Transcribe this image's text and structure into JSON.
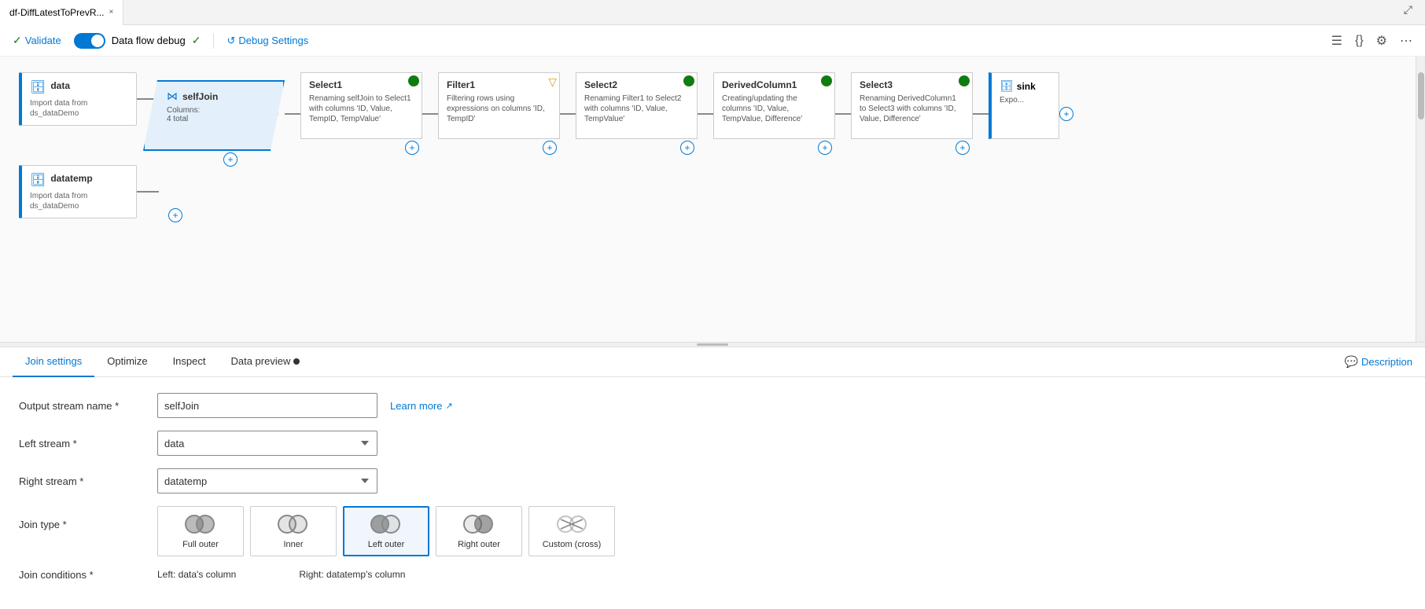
{
  "tab": {
    "title": "df-DiffLatestToPrevR...",
    "close_label": "×"
  },
  "toolbar": {
    "validate_label": "Validate",
    "debug_label": "Data flow debug",
    "debug_settings_label": "Debug Settings",
    "description_label": "Description"
  },
  "pipeline": {
    "nodes": [
      {
        "id": "data",
        "type": "source",
        "title": "data",
        "desc": "Import data from ds_dataDemo"
      },
      {
        "id": "datatemp",
        "type": "source",
        "title": "datatemp",
        "desc": "Import data from ds_dataDemo"
      },
      {
        "id": "selfJoin",
        "type": "join",
        "title": "selfJoin",
        "desc": "Columns: 4 total"
      },
      {
        "id": "Select1",
        "type": "transform",
        "title": "Select1",
        "desc": "Renaming selfJoin to Select1 with columns 'ID, Value, TempID, TempValue'"
      },
      {
        "id": "Filter1",
        "type": "filter",
        "title": "Filter1",
        "desc": "Filtering rows using expressions on columns 'ID, TempID'"
      },
      {
        "id": "Select2",
        "type": "transform",
        "title": "Select2",
        "desc": "Renaming Filter1 to Select2 with columns 'ID, Value, TempValue'"
      },
      {
        "id": "DerivedColumn1",
        "type": "transform",
        "title": "DerivedColumn1",
        "desc": "Creating/updating the columns 'ID, Value, TempValue, Difference'"
      },
      {
        "id": "Select3",
        "type": "transform",
        "title": "Select3",
        "desc": "Renaming DerivedColumn1 to Select3 with columns 'ID, Value, Difference'"
      },
      {
        "id": "sink",
        "type": "sink",
        "title": "sink",
        "desc": "Expo..."
      }
    ]
  },
  "settings": {
    "tabs": [
      "Join settings",
      "Optimize",
      "Inspect",
      "Data preview"
    ],
    "active_tab": "Join settings",
    "output_stream_label": "Output stream name *",
    "output_stream_value": "selfJoin",
    "left_stream_label": "Left stream *",
    "left_stream_value": "data",
    "right_stream_label": "Right stream *",
    "right_stream_value": "datatemp",
    "join_type_label": "Join type *",
    "join_types": [
      {
        "id": "full_outer",
        "label": "Full outer",
        "selected": false
      },
      {
        "id": "inner",
        "label": "Inner",
        "selected": false
      },
      {
        "id": "left_outer",
        "label": "Left outer",
        "selected": true
      },
      {
        "id": "right_outer",
        "label": "Right outer",
        "selected": false
      },
      {
        "id": "custom_cross",
        "label": "Custom (cross)",
        "selected": false
      }
    ],
    "join_conditions_label": "Join conditions *",
    "left_col_label": "Left: data's column",
    "right_col_label": "Right: datatemp's column",
    "learn_more_label": "Learn more",
    "description_btn_label": "Description"
  }
}
